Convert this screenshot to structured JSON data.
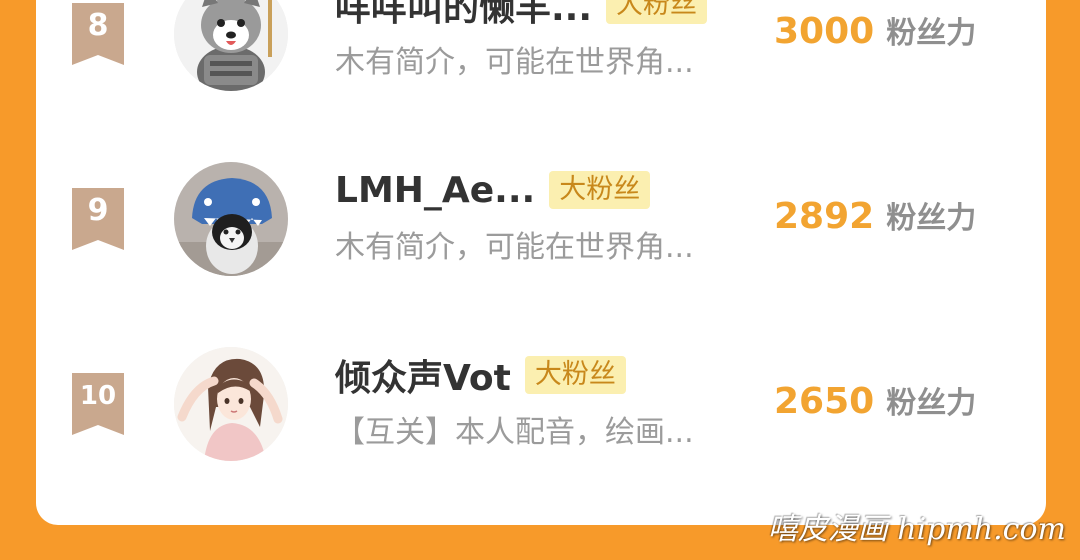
{
  "colors": {
    "background": "#f79a2a",
    "card": "#ffffff",
    "rank_ribbon": "#c9a88e",
    "badge_bg": "#fbefb0",
    "badge_text": "#c8881b",
    "score": "#f2a431",
    "name": "#333333",
    "intro": "#9b9b9b"
  },
  "ranking": [
    {
      "rank": "8",
      "name": "咩咩叫的懒羊...",
      "badge": "大粉丝",
      "intro": "木有简介，可能在世界角...",
      "score": "3000",
      "score_unit": "粉丝力",
      "avatar_icon": "armored-husky-avatar"
    },
    {
      "rank": "9",
      "name": "LMH_Ae...",
      "badge": "大粉丝",
      "intro": "木有简介，可能在世界角...",
      "score": "2892",
      "score_unit": "粉丝力",
      "avatar_icon": "penguin-shark-hood-avatar"
    },
    {
      "rank": "10",
      "name": "倾众声Vot",
      "badge": "大粉丝",
      "intro": "【互关】本人配音，绘画...",
      "score": "2650",
      "score_unit": "粉丝力",
      "avatar_icon": "anime-girl-avatar"
    }
  ],
  "watermark": "嘻皮漫画 hipmh.com"
}
